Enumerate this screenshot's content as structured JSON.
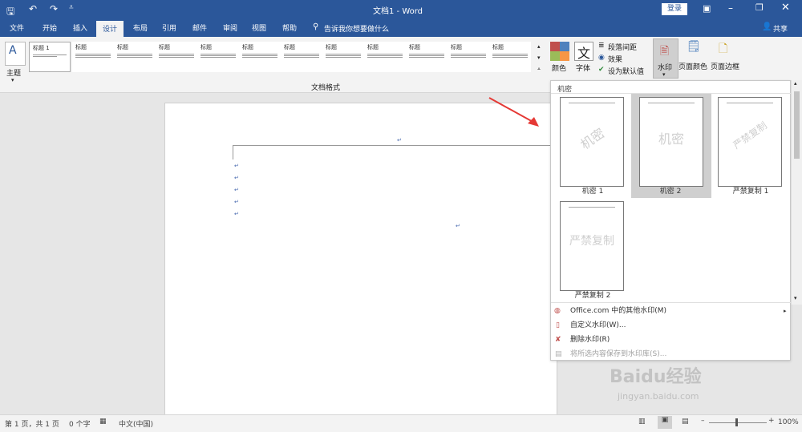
{
  "window": {
    "title": "文档1 - Word",
    "login": "登录",
    "share": "共享"
  },
  "tabs": [
    "文件",
    "开始",
    "插入",
    "设计",
    "布局",
    "引用",
    "邮件",
    "审阅",
    "视图",
    "帮助"
  ],
  "active_tab": "设计",
  "tell_me": "告诉我你想要做什么",
  "ribbon": {
    "theme_label": "主题",
    "doc_format_label": "文档格式",
    "style_titles": [
      "标题 1",
      "标题",
      "标题",
      "标题",
      "标题",
      "标题",
      "标题",
      "标题",
      "标题",
      "标题",
      "标题",
      "标题"
    ],
    "colors_label": "颜色",
    "fonts_label": "字体",
    "para_spacing": "段落间距",
    "effects": "效果",
    "set_default": "设为默认值",
    "watermark": "水印",
    "page_color": "页面颜色",
    "page_border": "页面边框"
  },
  "watermark_panel": {
    "section_title": "机密",
    "items": [
      {
        "label": "机密 1",
        "text": "机密"
      },
      {
        "label": "机密 2",
        "text": "机密"
      },
      {
        "label": "严禁复制 1",
        "text": "严禁复制"
      },
      {
        "label": "严禁复制 2",
        "text": "严禁复制"
      }
    ],
    "commands": [
      {
        "label": "Office.com 中的其他水印(M)",
        "disabled": false
      },
      {
        "label": "自定义水印(W)...",
        "disabled": false
      },
      {
        "label": "删除水印(R)",
        "disabled": false
      },
      {
        "label": "将所选内容保存到水印库(S)...",
        "disabled": true
      }
    ]
  },
  "status": {
    "page": "第 1 页，共 1 页",
    "words": "0 个字",
    "lang": "中文(中国)",
    "zoom": "100%"
  },
  "brand_watermark": {
    "text": "Baidu经验",
    "url": "jingyan.baidu.com"
  },
  "colors": {
    "accent": "#2b579a",
    "selected": "#cfcfcf"
  }
}
